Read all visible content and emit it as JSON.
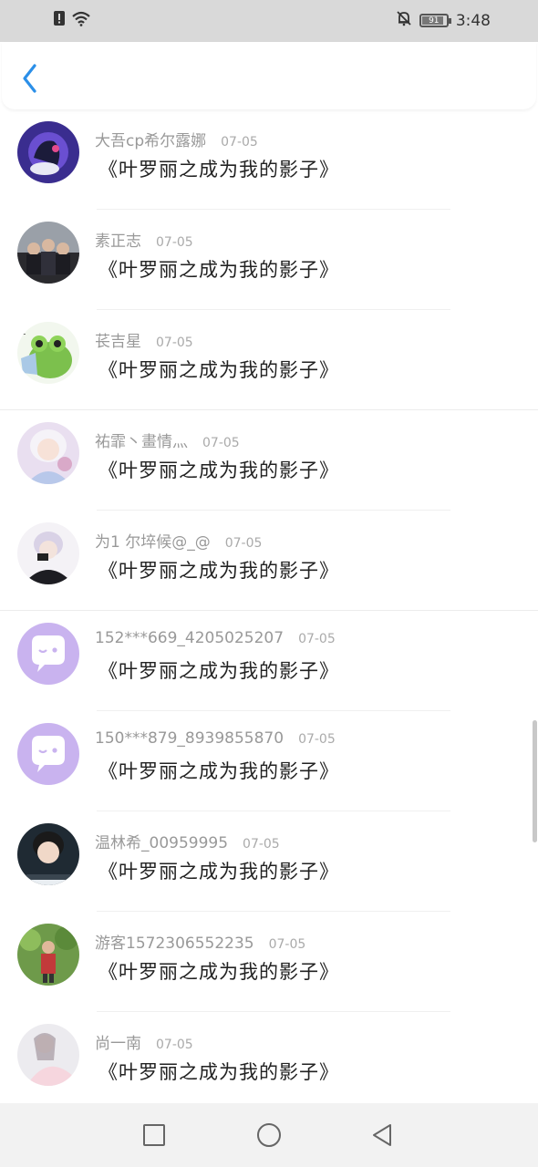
{
  "status_bar": {
    "time": "3:48",
    "battery_level": "91",
    "icons": [
      "alert-icon",
      "wifi-icon",
      "mute-icon",
      "battery-icon"
    ]
  },
  "header": {
    "back_icon": "chevron-left-icon",
    "accent_color": "#2b8fe8"
  },
  "comments": [
    {
      "user": "大吾cp希尔露娜",
      "date": "07-05",
      "text": "《叶罗丽之成为我的影子》"
    },
    {
      "user": "素正志",
      "date": "07-05",
      "text": "《叶罗丽之成为我的影子》"
    },
    {
      "user": "苌吉星",
      "date": "07-05",
      "text": "《叶罗丽之成为我的影子》"
    },
    {
      "user": "祐霏丶畫情灬",
      "date": "07-05",
      "text": "《叶罗丽之成为我的影子》"
    },
    {
      "user": "为1 尔埣候@_@",
      "date": "07-05",
      "text": "《叶罗丽之成为我的影子》"
    },
    {
      "user": "152***669_4205025207",
      "date": "07-05",
      "text": "《叶罗丽之成为我的影子》"
    },
    {
      "user": "150***879_8939855870",
      "date": "07-05",
      "text": "《叶罗丽之成为我的影子》"
    },
    {
      "user": "温林希_00959995",
      "date": "07-05",
      "text": "《叶罗丽之成为我的影子》"
    },
    {
      "user": "游客1572306552235",
      "date": "07-05",
      "text": "《叶罗丽之成为我的影子》"
    },
    {
      "user": "尚一南",
      "date": "07-05",
      "text": "《叶罗丽之成为我的影子》"
    }
  ],
  "nav": {
    "icons": [
      "recent-apps-icon",
      "home-icon",
      "back-icon"
    ]
  }
}
